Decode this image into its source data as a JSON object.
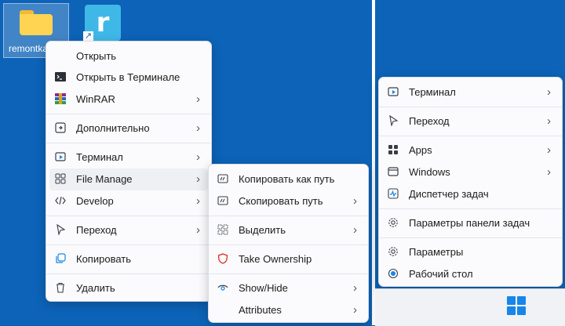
{
  "desktop": {
    "folder_label": "remontka"
  },
  "menu_main": {
    "items": [
      {
        "label": "Открыть",
        "icon": "none"
      },
      {
        "label": "Открыть в Терминале",
        "icon": "terminal-icon"
      },
      {
        "label": "WinRAR",
        "icon": "winrar-icon"
      },
      {
        "label": "Дополнительно",
        "icon": "more-icon"
      },
      {
        "label": "Терминал",
        "icon": "terminal-window-icon"
      },
      {
        "label": "File Manage",
        "icon": "grid-icon"
      },
      {
        "label": "Develop",
        "icon": "code-icon"
      },
      {
        "label": "Переход",
        "icon": "cursor-icon"
      },
      {
        "label": "Копировать",
        "icon": "copy-icon"
      },
      {
        "label": "Удалить",
        "icon": "trash-icon"
      }
    ]
  },
  "menu_sub": {
    "items": [
      {
        "label": "Копировать как путь",
        "icon": "path-icon"
      },
      {
        "label": "Скопировать путь",
        "icon": "path-icon"
      },
      {
        "label": "Выделить",
        "icon": "select-icon"
      },
      {
        "label": "Take Ownership",
        "icon": "shield-icon"
      },
      {
        "label": "Show/Hide",
        "icon": "eye-icon"
      },
      {
        "label": "Attributes",
        "icon": "none"
      }
    ]
  },
  "menu_taskbar": {
    "items": [
      {
        "label": "Терминал",
        "icon": "terminal-window-icon"
      },
      {
        "label": "Переход",
        "icon": "cursor-icon"
      },
      {
        "label": "Apps",
        "icon": "apps-icon"
      },
      {
        "label": "Windows",
        "icon": "windows-icon"
      },
      {
        "label": "Диспетчер задач",
        "icon": "task-manager-icon"
      },
      {
        "label": "Параметры панели задач",
        "icon": "gear-icon"
      },
      {
        "label": "Параметры",
        "icon": "gear-icon"
      },
      {
        "label": "Рабочий стол",
        "icon": "desktop-icon"
      }
    ]
  },
  "colors": {
    "desktop": "#0d63b8",
    "menu_bg": "#fbfbfd",
    "accent": "#1786e8",
    "shield": "#d93025"
  }
}
